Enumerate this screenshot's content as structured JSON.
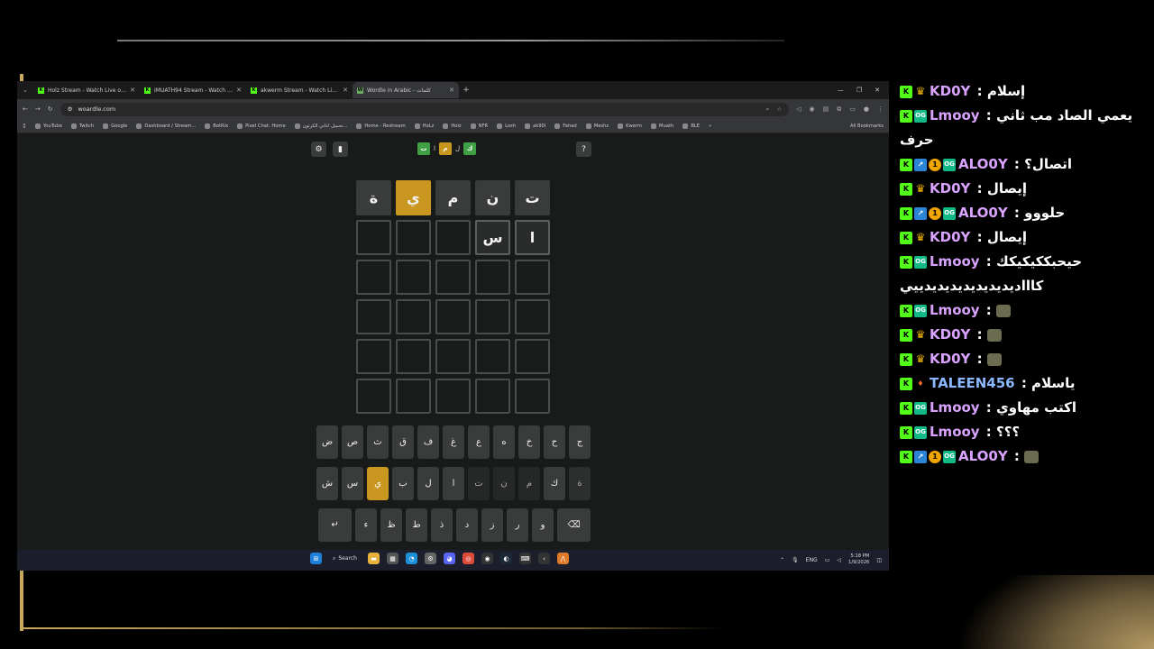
{
  "browser": {
    "tabs": [
      {
        "title": "Holz Stream - Watch Live on Ki",
        "icon": "K"
      },
      {
        "title": "IMUATH94 Stream - Watch Live",
        "icon": "K"
      },
      {
        "title": "akwerm Stream - Watch Live o",
        "icon": "K"
      },
      {
        "title": "Wordle in Arabic - كلمات",
        "icon": "W",
        "active": true
      }
    ],
    "url": "woardle.com",
    "bookmarks": [
      "YouTube",
      "Twitch",
      "Google",
      "Dashboard / Stream...",
      "BotRix",
      "Pixel Chat: Home",
      "تحميل اغاني الكرتون...",
      "Home - Restream",
      "HoLz",
      "Holz",
      "NFR",
      "Losh",
      "ak90l",
      "Fahad",
      "Meshz",
      "Kwerm",
      "Muath",
      "BLE"
    ],
    "all_bookmarks": "All Bookmarks"
  },
  "game": {
    "title_tiles": [
      {
        "ch": "ك",
        "c": "g"
      },
      {
        "ch": "ل",
        "c": "none"
      },
      {
        "ch": "م",
        "c": "y"
      },
      {
        "ch": "ا",
        "c": "none"
      },
      {
        "ch": "ت",
        "c": "g"
      }
    ],
    "help": "?",
    "rows": [
      [
        {
          "ch": "ت",
          "s": "g"
        },
        {
          "ch": "ن",
          "s": "g"
        },
        {
          "ch": "م",
          "s": "g"
        },
        {
          "ch": "ي",
          "s": "y"
        },
        {
          "ch": "ة",
          "s": "g"
        }
      ],
      [
        {
          "ch": "ا",
          "s": "f"
        },
        {
          "ch": "س",
          "s": "f"
        },
        {
          "ch": "",
          "s": ""
        },
        {
          "ch": "",
          "s": ""
        },
        {
          "ch": "",
          "s": ""
        }
      ],
      [
        {
          "ch": "",
          "s": ""
        },
        {
          "ch": "",
          "s": ""
        },
        {
          "ch": "",
          "s": ""
        },
        {
          "ch": "",
          "s": ""
        },
        {
          "ch": "",
          "s": ""
        }
      ],
      [
        {
          "ch": "",
          "s": ""
        },
        {
          "ch": "",
          "s": ""
        },
        {
          "ch": "",
          "s": ""
        },
        {
          "ch": "",
          "s": ""
        },
        {
          "ch": "",
          "s": ""
        }
      ],
      [
        {
          "ch": "",
          "s": ""
        },
        {
          "ch": "",
          "s": ""
        },
        {
          "ch": "",
          "s": ""
        },
        {
          "ch": "",
          "s": ""
        },
        {
          "ch": "",
          "s": ""
        }
      ],
      [
        {
          "ch": "",
          "s": ""
        },
        {
          "ch": "",
          "s": ""
        },
        {
          "ch": "",
          "s": ""
        },
        {
          "ch": "",
          "s": ""
        },
        {
          "ch": "",
          "s": ""
        }
      ]
    ],
    "keyboard": [
      [
        {
          "k": "ج"
        },
        {
          "k": "ح"
        },
        {
          "k": "خ"
        },
        {
          "k": "ه"
        },
        {
          "k": "ع"
        },
        {
          "k": "غ"
        },
        {
          "k": "ف"
        },
        {
          "k": "ق"
        },
        {
          "k": "ث"
        },
        {
          "k": "ص"
        },
        {
          "k": "ض"
        }
      ],
      [
        {
          "k": "ة",
          "s": "tr"
        },
        {
          "k": "ك"
        },
        {
          "k": "م",
          "s": "dim"
        },
        {
          "k": "ن",
          "s": "dim"
        },
        {
          "k": "ت",
          "s": "dim"
        },
        {
          "k": "ا"
        },
        {
          "k": "ل"
        },
        {
          "k": "ب"
        },
        {
          "k": "ي",
          "s": "y"
        },
        {
          "k": "س"
        },
        {
          "k": "ش"
        }
      ],
      [
        {
          "k": "⌫",
          "s": "wide"
        },
        {
          "k": "و"
        },
        {
          "k": "ر"
        },
        {
          "k": "ز"
        },
        {
          "k": "د"
        },
        {
          "k": "ذ"
        },
        {
          "k": "ط"
        },
        {
          "k": "ظ"
        },
        {
          "k": "ء"
        },
        {
          "k": "↵",
          "s": "wide"
        }
      ]
    ]
  },
  "taskbar": {
    "search": "Search",
    "lang": "ENG",
    "time": "5:18 PM",
    "date": "1/9/2026"
  },
  "chat": [
    {
      "user": "KD0Y",
      "badges": [
        "K",
        "crown"
      ],
      "text": "إسلام",
      "cls": "kd"
    },
    {
      "user": "Lmooy",
      "badges": [
        "K",
        "og"
      ],
      "text": "يعمي الصاد مب ثاني حرف",
      "cls": "lm"
    },
    {
      "user": "ALO0Y",
      "badges": [
        "K",
        "up",
        "1",
        "og"
      ],
      "text": "اتصال؟",
      "cls": "al"
    },
    {
      "user": "KD0Y",
      "badges": [
        "K",
        "crown"
      ],
      "text": "إيصال",
      "cls": "kd"
    },
    {
      "user": "ALO0Y",
      "badges": [
        "K",
        "up",
        "1",
        "og"
      ],
      "text": "حلووو",
      "cls": "al"
    },
    {
      "user": "KD0Y",
      "badges": [
        "K",
        "crown"
      ],
      "text": "إيصال",
      "cls": "kd"
    },
    {
      "user": "Lmooy",
      "badges": [
        "K",
        "og"
      ],
      "text": "حيحبككيكيكك كاااديديديديديديديدييي",
      "cls": "lm"
    },
    {
      "user": "Lmooy",
      "badges": [
        "K",
        "og"
      ],
      "text": "",
      "emote": true,
      "cls": "lm"
    },
    {
      "user": "KD0Y",
      "badges": [
        "K",
        "crown"
      ],
      "text": "",
      "emote": true,
      "cls": "kd"
    },
    {
      "user": "KD0Y",
      "badges": [
        "K",
        "crown"
      ],
      "text": "",
      "emote": true,
      "cls": "kd"
    },
    {
      "user": "TALEEN456",
      "badges": [
        "K",
        "fire"
      ],
      "text": "ياسلام",
      "cls": "ta"
    },
    {
      "user": "Lmooy",
      "badges": [
        "K",
        "og"
      ],
      "text": "اكتب مهاوي",
      "cls": "lm"
    },
    {
      "user": "Lmooy",
      "badges": [
        "K",
        "og"
      ],
      "text": "؟؟؟",
      "cls": "lm"
    },
    {
      "user": "ALO0Y",
      "badges": [
        "K",
        "up",
        "1",
        "og"
      ],
      "text": "",
      "emote": true,
      "cls": "al"
    }
  ]
}
